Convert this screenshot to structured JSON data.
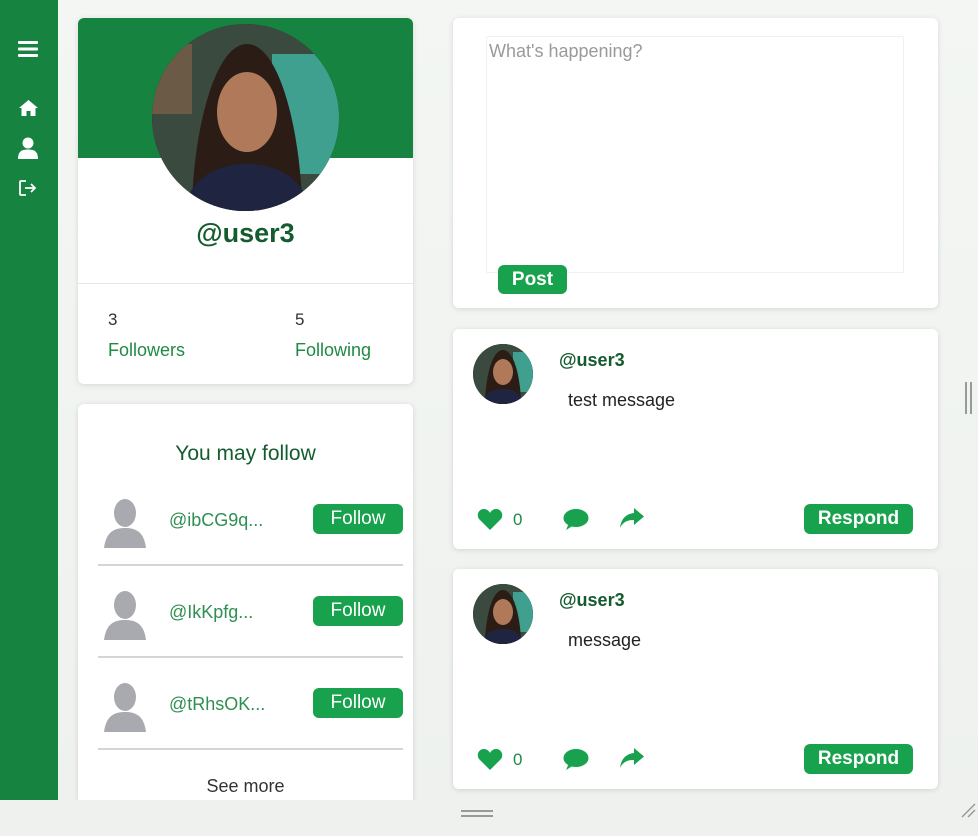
{
  "sidebar": {
    "icons": [
      "menu-icon",
      "home-icon",
      "user-icon",
      "logout-icon"
    ]
  },
  "profile": {
    "handle": "@user3",
    "followers_count": "3",
    "followers_label": "Followers",
    "following_count": "5",
    "following_label": "Following"
  },
  "suggestions": {
    "title": "You may follow",
    "items": [
      {
        "handle": "@ibCG9q...",
        "button": "Follow"
      },
      {
        "handle": "@IkKpfg...",
        "button": "Follow"
      },
      {
        "handle": "@tRhsOK...",
        "button": "Follow"
      }
    ],
    "see_more": "See more"
  },
  "compose": {
    "placeholder": "What's happening?",
    "post_label": "Post"
  },
  "posts": [
    {
      "handle": "@user3",
      "text": "test message",
      "likes": "0",
      "respond_label": "Respond"
    },
    {
      "handle": "@user3",
      "text": "message",
      "likes": "0",
      "respond_label": "Respond"
    }
  ],
  "colors": {
    "brand": "#178341",
    "button": "#18a24d",
    "handle": "#145c2f"
  }
}
